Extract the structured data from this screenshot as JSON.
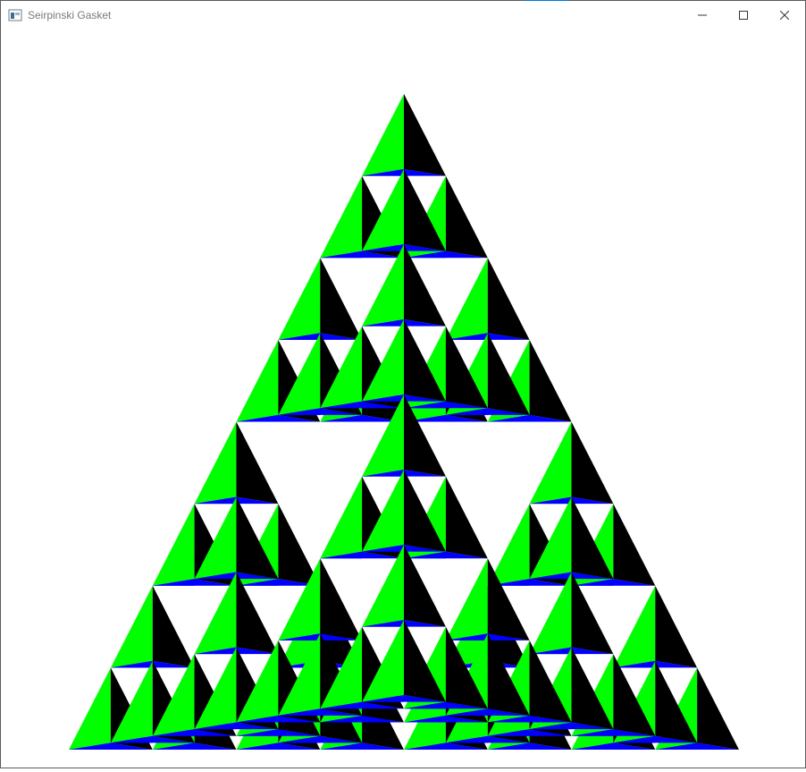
{
  "window": {
    "title": "Seirpinski Gasket",
    "app_icon": "window-app-icon",
    "controls": [
      {
        "name": "minimize-button",
        "icon": "minimize-icon"
      },
      {
        "name": "maximize-button",
        "icon": "maximize-icon"
      },
      {
        "name": "close-button",
        "icon": "close-icon"
      }
    ]
  },
  "gasket": {
    "levels": 3,
    "colors": {
      "left_face": "#00ff00",
      "right_face": "#000000",
      "bottom_face": "#0000ff",
      "background": "#ffffff",
      "edge_highlight": "#ff0000"
    }
  }
}
